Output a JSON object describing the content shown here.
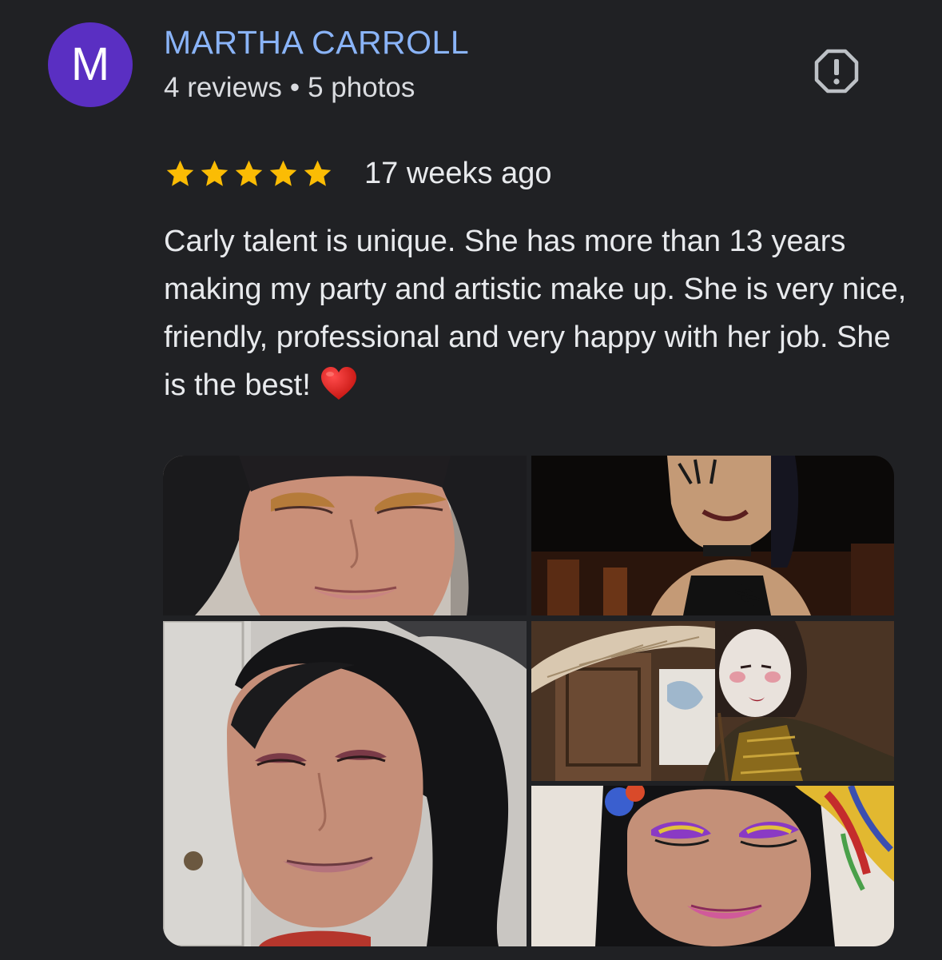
{
  "author": {
    "initial": "M",
    "name": "MARTHA CARROLL",
    "reviews": "4 reviews",
    "separator": "•",
    "photos": "5 photos",
    "avatar_color": "#5a2fc2",
    "name_color": "#8ab4f8"
  },
  "review": {
    "rating": 5,
    "max_rating": 5,
    "star_color": "#fbbc04",
    "time": "17 weeks ago",
    "text": "Carly talent is unique. She has more than 13 years making my party and artistic make up. She is very nice, friendly, professional and very happy with her job. She is the best!",
    "emoji": "heart-emoji"
  },
  "actions": {
    "report_icon": "report-icon"
  },
  "photos": [
    {
      "name": "photo-woman-gold-eyeshadow"
    },
    {
      "name": "photo-woman-halloween-makeup"
    },
    {
      "name": "photo-woman-smiling-closeup"
    },
    {
      "name": "photo-woman-geisha-umbrella"
    },
    {
      "name": "photo-woman-purple-eyeshadow-flowers"
    }
  ]
}
